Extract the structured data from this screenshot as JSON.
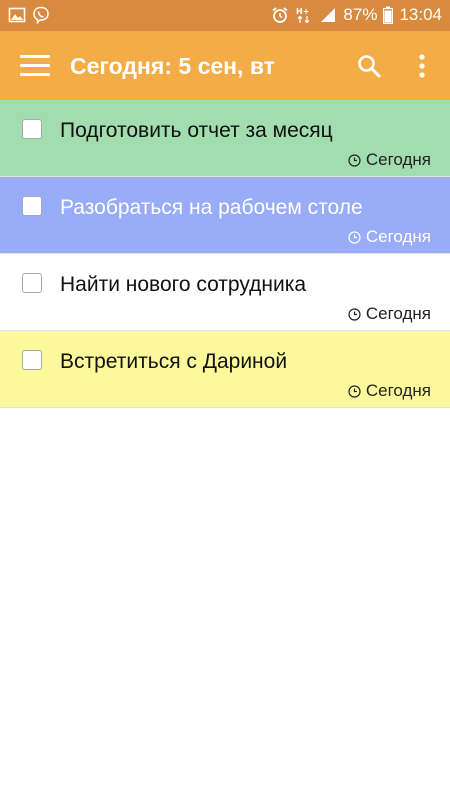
{
  "colors": {
    "status_bar": "#d88a3f",
    "app_bar": "#f4ac47",
    "task_green": "#a2ddb0",
    "task_blue": "#98acf8",
    "task_white": "#ffffff",
    "task_yellow": "#fbf99c"
  },
  "status_bar": {
    "left_icons": [
      "image-icon",
      "viber-icon"
    ],
    "right_icons": [
      "alarm-icon",
      "network-hplus-icon",
      "signal-icon"
    ],
    "battery": "87%",
    "time": "13:04"
  },
  "app_bar": {
    "title": "Сегодня: 5 сен, вт",
    "menu_icon": "hamburger-menu-icon",
    "search_icon": "search-icon",
    "more_icon": "more-vert-icon"
  },
  "tasks": [
    {
      "title": "Подготовить отчет за месяц",
      "due": "Сегодня",
      "checked": false,
      "color": "#a2ddb0",
      "text_color": "#111111",
      "due_color": "#222222"
    },
    {
      "title": "Разобраться на рабочем столе",
      "due": "Сегодня",
      "checked": false,
      "color": "#98acf8",
      "text_color": "#ffffff",
      "due_color": "#ffffff"
    },
    {
      "title": "Найти нового сотрудника",
      "due": "Сегодня",
      "checked": false,
      "color": "#ffffff",
      "text_color": "#111111",
      "due_color": "#222222"
    },
    {
      "title": "Встретиться с Дариной",
      "due": "Сегодня",
      "checked": false,
      "color": "#fbf99c",
      "text_color": "#111111",
      "due_color": "#222222"
    }
  ]
}
